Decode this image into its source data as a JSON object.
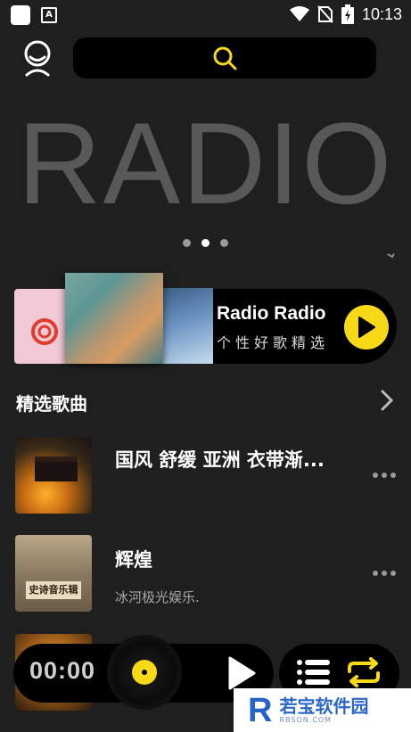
{
  "status_bar": {
    "time": "10:13",
    "app_badge": "A"
  },
  "header": {
    "profile_icon": "profile-icon",
    "search_icon": "search-icon"
  },
  "banner": {
    "title": "RADIO",
    "dots": 3,
    "active_dot": 2
  },
  "radio_card": {
    "title": "Radio Radio",
    "subtitle": "个性好歌精选",
    "play_color": "#f7d917"
  },
  "section": {
    "title": "精选歌曲"
  },
  "songs": [
    {
      "title": "国风 舒缓 亚洲 衣带渐...",
      "artist": ""
    },
    {
      "title": "辉煌",
      "artist": "冰河极光娱乐.",
      "cover_label": "史诗音乐辑"
    },
    {
      "title": "",
      "artist": ""
    }
  ],
  "player": {
    "time": "00:00",
    "accent": "#f7d917"
  },
  "watermark": {
    "logo": "R",
    "text": "若宝软件园",
    "sub": "RBSON.COM"
  }
}
